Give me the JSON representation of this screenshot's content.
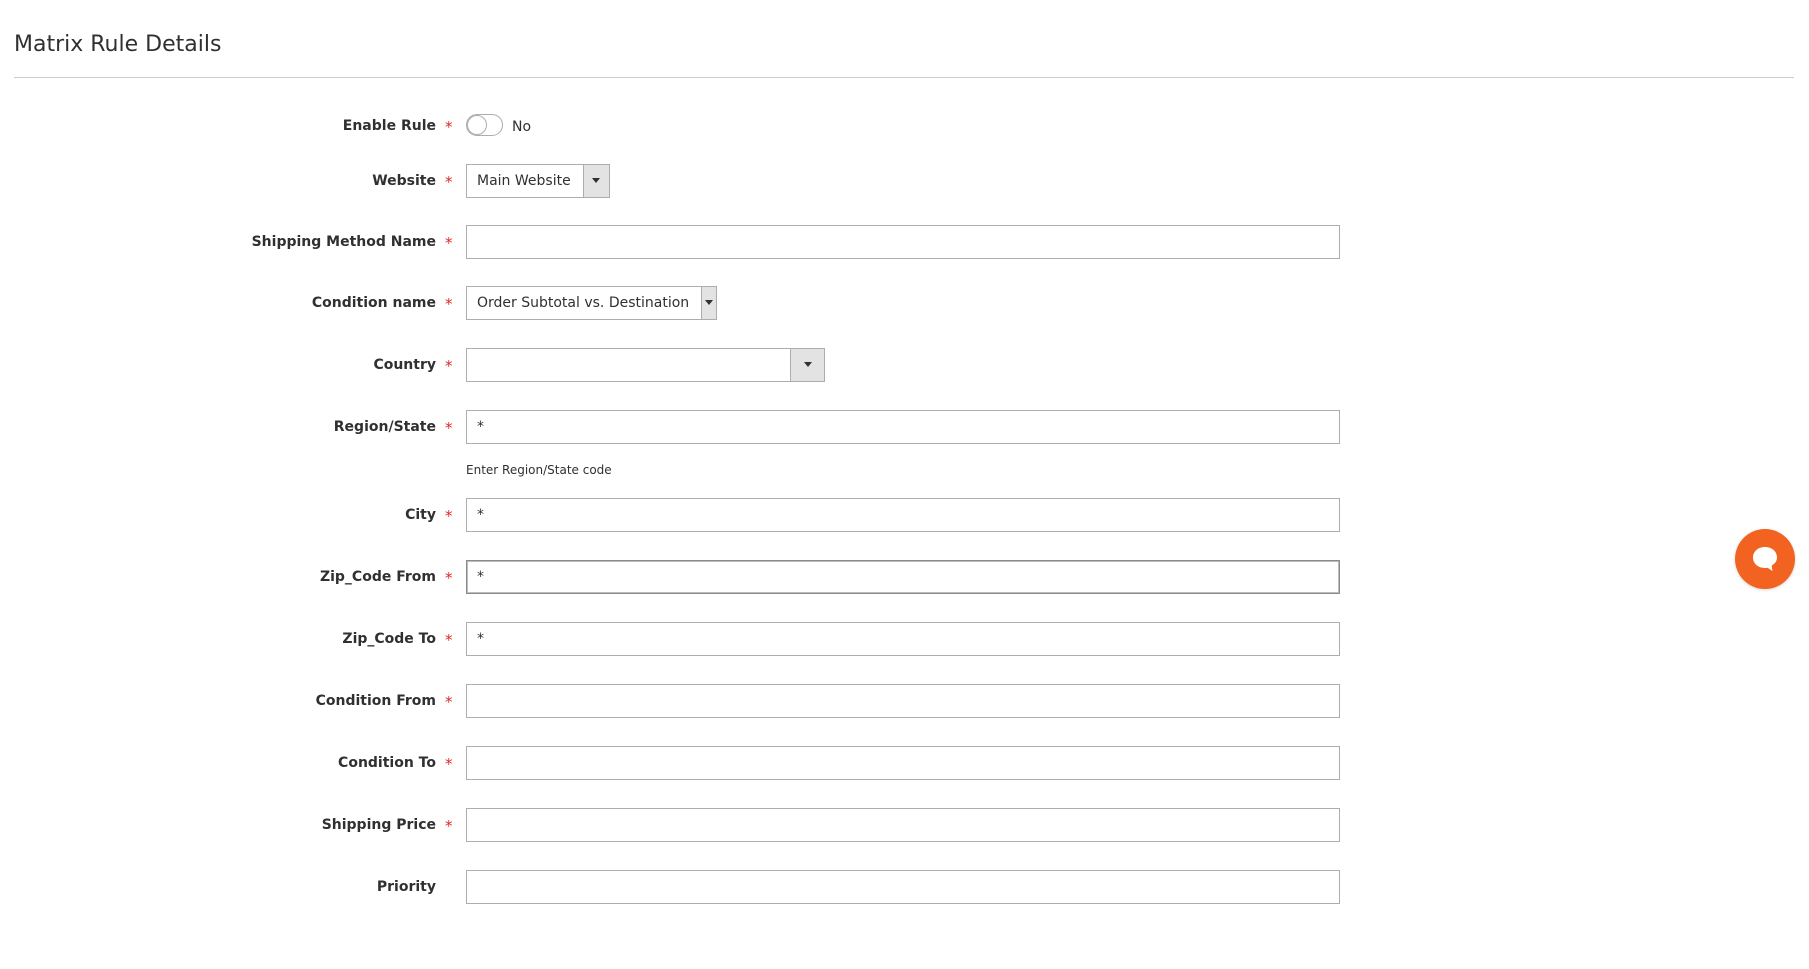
{
  "section": {
    "title": "Matrix Rule Details"
  },
  "fields": {
    "enable_rule": {
      "label": "Enable Rule",
      "required_mark": "*",
      "value_text": "No",
      "enabled": false
    },
    "website": {
      "label": "Website",
      "required_mark": "*",
      "value": "Main Website"
    },
    "shipping_method_name": {
      "label": "Shipping Method Name",
      "required_mark": "*",
      "value": ""
    },
    "condition_name": {
      "label": "Condition name",
      "required_mark": "*",
      "value": "Order Subtotal vs. Destination"
    },
    "country": {
      "label": "Country",
      "required_mark": "*",
      "value": ""
    },
    "region_state": {
      "label": "Region/State",
      "required_mark": "*",
      "value": "*",
      "note": "Enter Region/State code"
    },
    "city": {
      "label": "City",
      "required_mark": "*",
      "value": "*"
    },
    "zip_code_from": {
      "label": "Zip_Code From",
      "required_mark": "*",
      "value": "*"
    },
    "zip_code_to": {
      "label": "Zip_Code To",
      "required_mark": "*",
      "value": "*"
    },
    "condition_from": {
      "label": "Condition From",
      "required_mark": "*",
      "value": ""
    },
    "condition_to": {
      "label": "Condition To",
      "required_mark": "*",
      "value": ""
    },
    "shipping_price": {
      "label": "Shipping Price",
      "required_mark": "*",
      "value": ""
    },
    "priority": {
      "label": "Priority",
      "value": ""
    }
  },
  "icons": {
    "select_arrow": "chevron-down-icon",
    "chat": "chat-bubble-icon"
  },
  "colors": {
    "required": "#e22626",
    "chat_button": "#f26322",
    "border": "#adadad",
    "select_arrow_bg": "#e3e3e3"
  }
}
